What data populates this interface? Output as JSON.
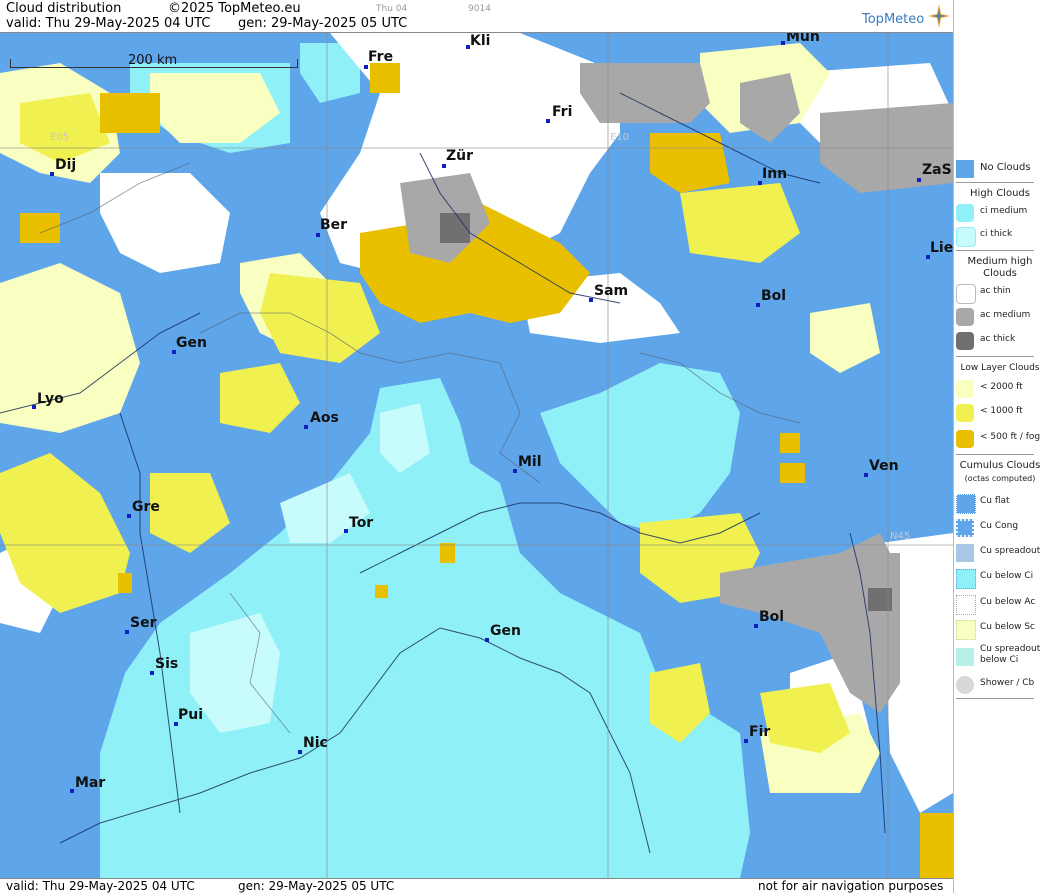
{
  "header": {
    "title": "Cloud distribution",
    "copyright": "©2025 TopMeteo.eu",
    "valid": "valid:  Thu  29-May-2025  04 UTC",
    "generated": "gen: 29-May-2025 05 UTC",
    "tab_day": "Thu 04",
    "code": "9014",
    "logo": "TopMeteo"
  },
  "map": {
    "scale_label": "200 km",
    "grid_labels": [
      "E05",
      "E10",
      "N45"
    ],
    "cities": [
      {
        "name": "Kli"
      },
      {
        "name": "Mun"
      },
      {
        "name": "Fre"
      },
      {
        "name": "Fri"
      },
      {
        "name": "Dij"
      },
      {
        "name": "Zür"
      },
      {
        "name": "Inn"
      },
      {
        "name": "ZaS"
      },
      {
        "name": "Ber"
      },
      {
        "name": "Lie"
      },
      {
        "name": "Sam"
      },
      {
        "name": "Bol"
      },
      {
        "name": "Gen"
      },
      {
        "name": "Lyo"
      },
      {
        "name": "Aos"
      },
      {
        "name": "Mil"
      },
      {
        "name": "Ven"
      },
      {
        "name": "Gre"
      },
      {
        "name": "Tor"
      },
      {
        "name": "Ser"
      },
      {
        "name": "Gen"
      },
      {
        "name": "Bol"
      },
      {
        "name": "Sis"
      },
      {
        "name": "Pui"
      },
      {
        "name": "Nic"
      },
      {
        "name": "Fir"
      },
      {
        "name": "Mar"
      }
    ],
    "colors": {
      "no_clouds": "#5ea5ea",
      "ci_medium": "#8ff0f8",
      "ci_thick": "#c8fcfc",
      "ac_thin": "#ffffff",
      "ac_medium": "#a8a8a8",
      "ac_thick": "#707070",
      "low_2000": "#f8ffc0",
      "low_1000": "#f0f050",
      "low_500": "#e8c000"
    }
  },
  "legend": {
    "no_clouds": "No Clouds",
    "high_head": "High Clouds",
    "ci_medium": "ci medium",
    "ci_thick": "ci thick",
    "medium_head": "Medium high Clouds",
    "ac_thin": "ac thin",
    "ac_medium": "ac medium",
    "ac_thick": "ac thick",
    "low_head": "Low Layer Clouds",
    "low_2000": "< 2000 ft",
    "low_1000": "< 1000 ft",
    "low_500": "< 500 ft / fog",
    "cu_head": "Cumulus Clouds",
    "cu_sub": "(octas computed)",
    "cu_flat": "Cu flat",
    "cu_cong": "Cu Cong",
    "cu_spread": "Cu spreadout",
    "cu_below_ci": "Cu below Ci",
    "cu_below_ac": "Cu below Ac",
    "cu_below_sc": "Cu below Sc",
    "cu_spread_ci": "Cu spreadout below Ci",
    "shower": "Shower / Cb"
  },
  "footer": {
    "valid": "valid:  Thu  29-May-2025  04 UTC",
    "generated": "gen: 29-May-2025 05 UTC",
    "disclaimer": "not for air navigation purposes"
  }
}
